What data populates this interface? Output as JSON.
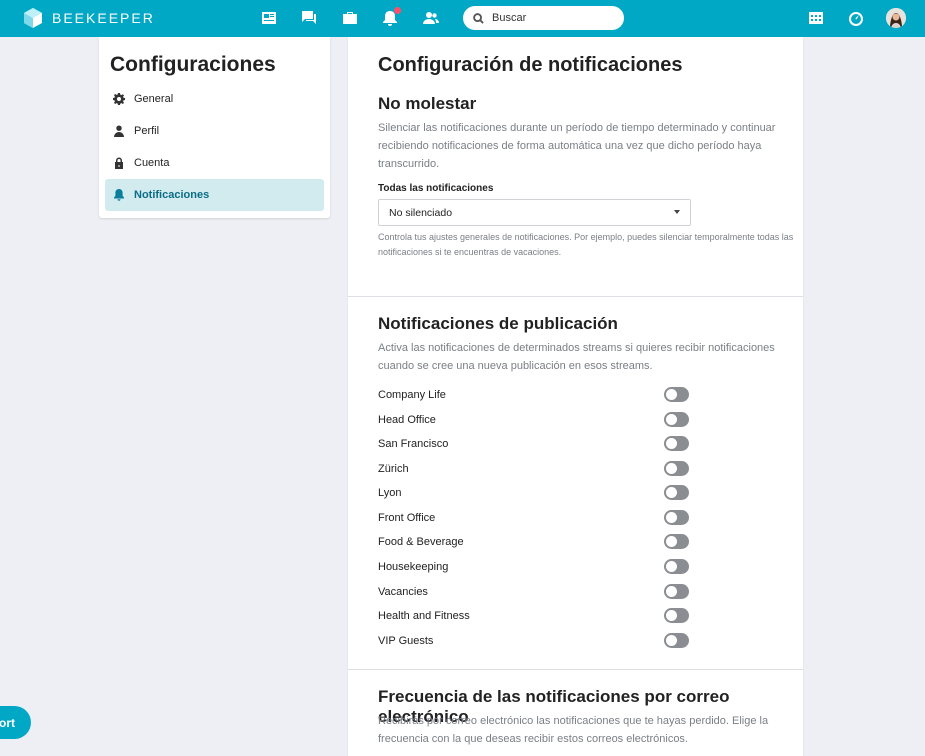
{
  "header": {
    "brand": "BEEKEEPER",
    "search_placeholder": "Buscar",
    "nav_icons": [
      "news-feed-icon",
      "chat-icon",
      "tools-icon",
      "notifications-icon",
      "people-icon"
    ],
    "right_icons": [
      "shifts-icon",
      "dashboard-icon"
    ],
    "accent": "#00a8c6",
    "notification_dot_color": "#ff4f6b"
  },
  "sidebar": {
    "title": "Configuraciones",
    "items": [
      {
        "label": "General",
        "icon": "gear-icon"
      },
      {
        "label": "Perfil",
        "icon": "person-icon"
      },
      {
        "label": "Cuenta",
        "icon": "lock-icon"
      },
      {
        "label": "Notificaciones",
        "icon": "bell-icon",
        "active": true
      }
    ]
  },
  "main": {
    "title": "Configuración de notificaciones",
    "dnd": {
      "heading": "No molestar",
      "description": "Silenciar las notificaciones durante un período de tiempo determinado y continuar recibiendo notificaciones de forma automática una vez que dicho período haya transcurrido.",
      "field_label": "Todas las notificaciones",
      "select_value": "No silenciado",
      "help": "Controla tus ajustes generales de notificaciones. Por ejemplo, puedes silenciar temporalmente todas las notificaciones si te encuentras de vacaciones."
    },
    "post_notifications": {
      "heading": "Notificaciones de publicación",
      "description": "Activa las notificaciones de determinados streams si quieres recibir notificaciones cuando se cree una nueva publicación en esos streams.",
      "streams": [
        {
          "name": "Company Life",
          "enabled": false
        },
        {
          "name": "Head Office",
          "enabled": false
        },
        {
          "name": "San Francisco",
          "enabled": false
        },
        {
          "name": "Zürich",
          "enabled": false
        },
        {
          "name": "Lyon",
          "enabled": false
        },
        {
          "name": "Front Office",
          "enabled": false
        },
        {
          "name": "Food & Beverage",
          "enabled": false
        },
        {
          "name": "Housekeeping",
          "enabled": false
        },
        {
          "name": "Vacancies",
          "enabled": false
        },
        {
          "name": "Health and Fitness",
          "enabled": false
        },
        {
          "name": "VIP Guests",
          "enabled": false
        }
      ]
    },
    "email_frequency": {
      "heading": "Frecuencia de las notificaciones por correo electrónico",
      "description": "Recibirás por correo electrónico las notificaciones que te hayas perdido. Elige la frecuencia con la que deseas recibir estos correos electrónicos."
    }
  },
  "support_button": "ort"
}
